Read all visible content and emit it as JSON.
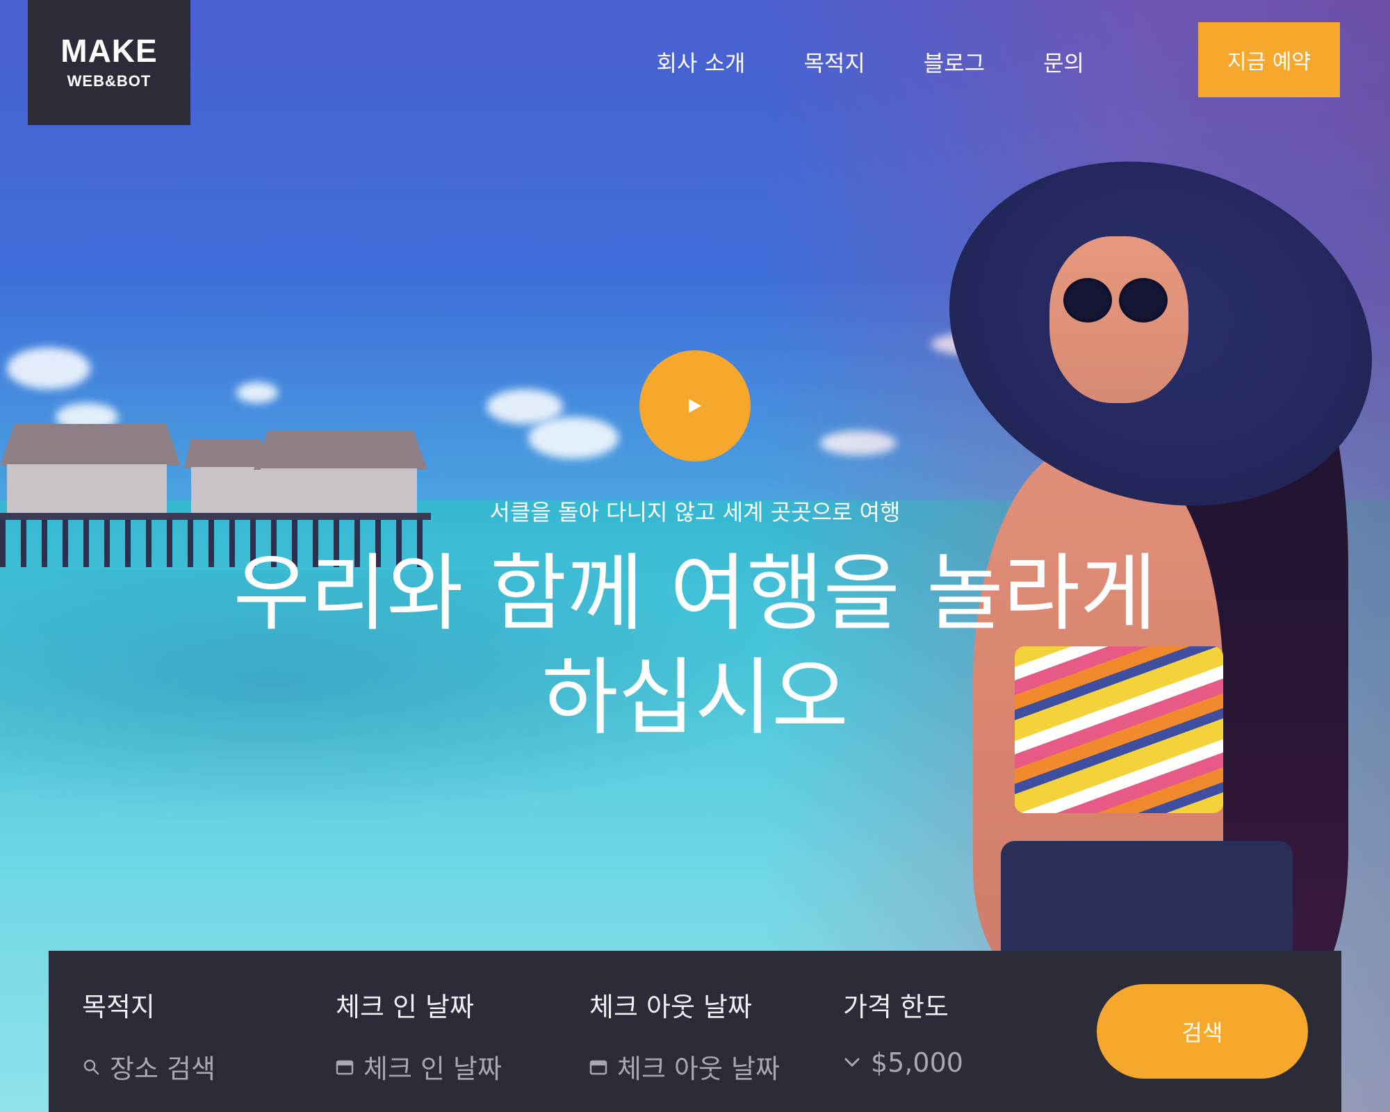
{
  "brand": {
    "name": "MAKE",
    "sub": "WEB&BOT"
  },
  "nav": {
    "items": [
      {
        "label": "회사 소개"
      },
      {
        "label": "목적지"
      },
      {
        "label": "블로그"
      },
      {
        "label": "문의"
      }
    ],
    "cta_label": "지금 예약"
  },
  "hero": {
    "tagline": "서클을 돌아 다니지 않고 세계 곳곳으로 여행",
    "headline": "우리와 함께 여행을 놀라게 하십시오",
    "play_icon": "play-icon"
  },
  "search": {
    "fields": [
      {
        "label": "목적지",
        "placeholder": "장소 검색",
        "icon": "search-icon"
      },
      {
        "label": "체크 인 날짜",
        "placeholder": "체크 인 날짜",
        "icon": "calendar-icon"
      },
      {
        "label": "체크 아웃 날짜",
        "placeholder": "체크 아웃 날짜",
        "icon": "calendar-icon"
      },
      {
        "label": "가격 한도",
        "value": "$5,000",
        "icon": "chevron-down-icon"
      }
    ],
    "button_label": "검색"
  },
  "colors": {
    "accent": "#f6a82c",
    "dark": "#2c2b38"
  }
}
